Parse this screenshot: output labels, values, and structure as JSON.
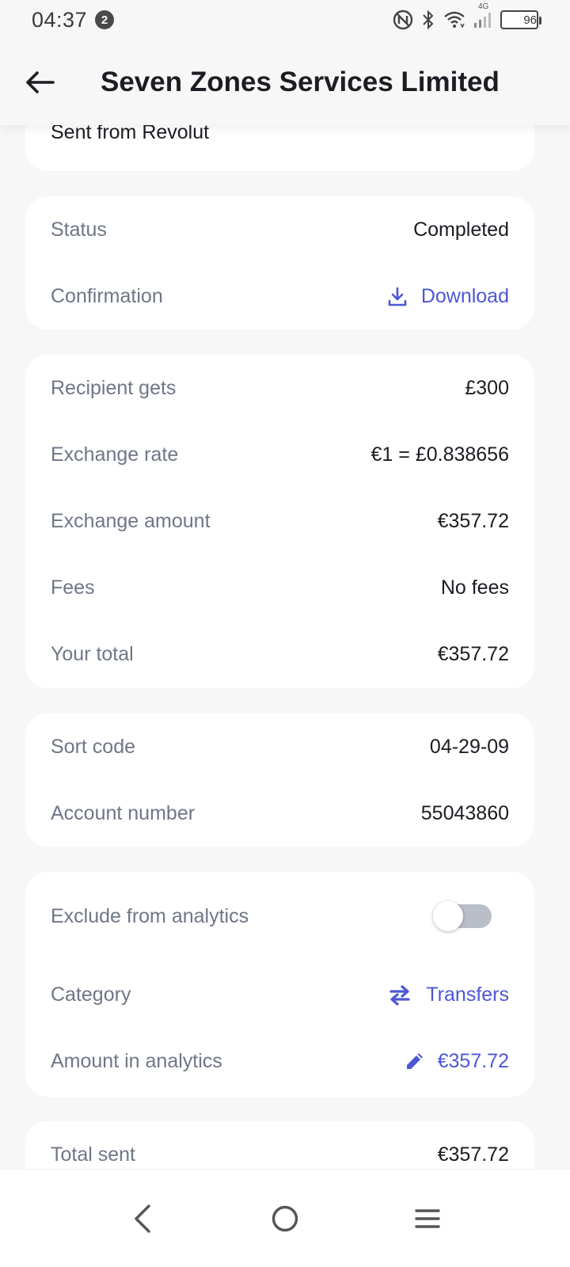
{
  "status_bar": {
    "time": "04:37",
    "notification_count": "2",
    "network_type": "4G",
    "battery": "96",
    "battery_level": 0.96
  },
  "header": {
    "title": "Seven Zones Services Limited"
  },
  "origin": {
    "text": "Sent from Revolut"
  },
  "status_card": {
    "status_label": "Status",
    "status_value": "Completed",
    "confirmation_label": "Confirmation",
    "confirmation_action": "Download"
  },
  "amounts_card": {
    "rows": [
      {
        "label": "Recipient gets",
        "value": "£300"
      },
      {
        "label": "Exchange rate",
        "value": "€1 = £0.838656"
      },
      {
        "label": "Exchange amount",
        "value": "€357.72"
      },
      {
        "label": "Fees",
        "value": "No fees"
      },
      {
        "label": "Your total",
        "value": "€357.72"
      }
    ]
  },
  "bank_card": {
    "rows": [
      {
        "label": "Sort code",
        "value": "04-29-09"
      },
      {
        "label": "Account number",
        "value": "55043860"
      }
    ]
  },
  "analytics_card": {
    "exclude_label": "Exclude from analytics",
    "exclude_enabled": false,
    "category_label": "Category",
    "category_value": "Transfers",
    "amount_label": "Amount in analytics",
    "amount_value": "€357.72"
  },
  "total_card": {
    "label": "Total sent",
    "value": "€357.72"
  },
  "colors": {
    "accent": "#4c57d6",
    "label": "#6f7686",
    "background": "#f7f7f7",
    "card": "#ffffff"
  },
  "icons": {
    "back": "arrow-left-icon",
    "download": "download-icon",
    "category": "swap-arrows-icon",
    "edit": "pencil-icon"
  }
}
